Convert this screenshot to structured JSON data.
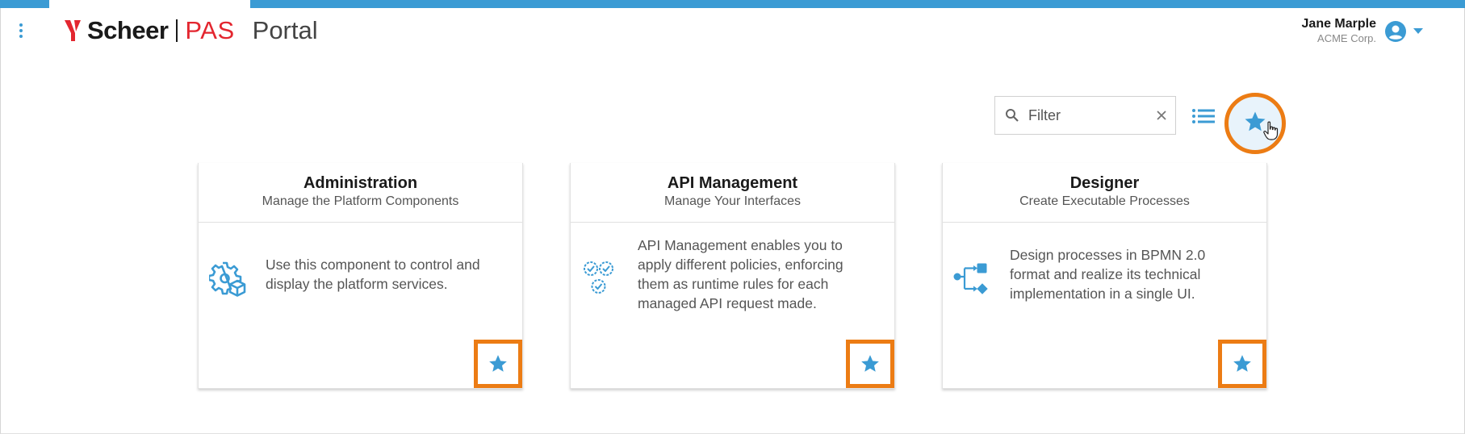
{
  "colors": {
    "accent": "#3b9bd4",
    "highlight": "#ec7c14",
    "brand_red": "#e3262f"
  },
  "header": {
    "menu_icon": "more-vertical-icon",
    "logo": {
      "brand": "Scheer",
      "product": "PAS",
      "app_name": "Portal"
    },
    "user": {
      "name": "Jane Marple",
      "organization": "ACME Corp.",
      "avatar_icon": "account-circle-icon",
      "menu_icon": "caret-down-icon"
    }
  },
  "toolbar": {
    "filter": {
      "placeholder": "Filter",
      "value": "",
      "search_icon": "search-icon",
      "clear_icon": "close-icon"
    },
    "list_view_icon": "list-view-icon",
    "favorites_toggle_icon": "star-icon",
    "favorites_toggle_highlighted": true
  },
  "cards": [
    {
      "title": "Administration",
      "subtitle": "Manage the Platform Components",
      "description": "Use this component to control and display the platform services.",
      "icon": "gears-cube-icon",
      "favorite_icon": "star-icon",
      "is_favorite": true
    },
    {
      "title": "API Management",
      "subtitle": "Manage Your Interfaces",
      "description": "API Management enables you to apply different policies, enforcing them as runtime rules for each managed API request made.",
      "icon": "gears-check-icon",
      "favorite_icon": "star-icon",
      "is_favorite": true
    },
    {
      "title": "Designer",
      "subtitle": "Create Executable Processes",
      "description": "Design processes in BPMN 2.0 format and realize its technical implementation in a single UI.",
      "icon": "process-flow-icon",
      "favorite_icon": "star-icon",
      "is_favorite": true
    }
  ]
}
